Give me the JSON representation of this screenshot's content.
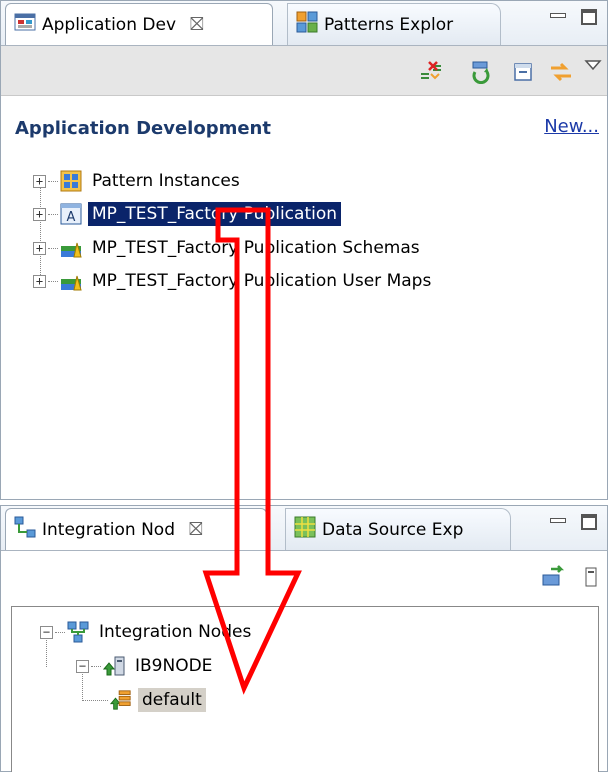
{
  "top_panel": {
    "tabs": [
      {
        "label": "Application Dev",
        "active": true,
        "icon": "application-dev-icon"
      },
      {
        "label": "Patterns Explor",
        "active": false,
        "icon": "patterns-explorer-icon"
      }
    ],
    "toolbar_icons": [
      "remove-mappings-icon",
      "refresh-icon",
      "collapse-all-icon",
      "link-with-editor-icon",
      "view-menu-icon"
    ],
    "header": {
      "title": "Application Development",
      "link": "New..."
    },
    "tree": [
      {
        "label": "Pattern Instances",
        "icon": "pattern-instances-icon",
        "selected": false
      },
      {
        "label": "MP_TEST_Factory Publication",
        "icon": "application-icon",
        "selected": true
      },
      {
        "label": "MP_TEST_Factory Publication Schemas",
        "icon": "library-icon",
        "selected": false
      },
      {
        "label": "MP_TEST_Factory Publication User Maps",
        "icon": "library-icon",
        "selected": false
      }
    ]
  },
  "bottom_panel": {
    "tabs": [
      {
        "label": "Integration Nod",
        "active": true,
        "icon": "integration-nodes-icon"
      },
      {
        "label": "Data Source Exp",
        "active": false,
        "icon": "data-source-explorer-icon"
      }
    ],
    "toolbar_icons": [
      "deploy-icon",
      "view-menu-icon"
    ],
    "tree": [
      {
        "label": "Integration Nodes",
        "icon": "integration-nodes-icon"
      },
      {
        "label": "IB9NODE",
        "icon": "node-icon"
      },
      {
        "label": "default",
        "icon": "integration-server-icon",
        "selected": true
      }
    ]
  },
  "colors": {
    "selection": "#0a246a",
    "arrow": "#ff0000",
    "link": "#1c3aa8",
    "header": "#1c3a6c"
  }
}
